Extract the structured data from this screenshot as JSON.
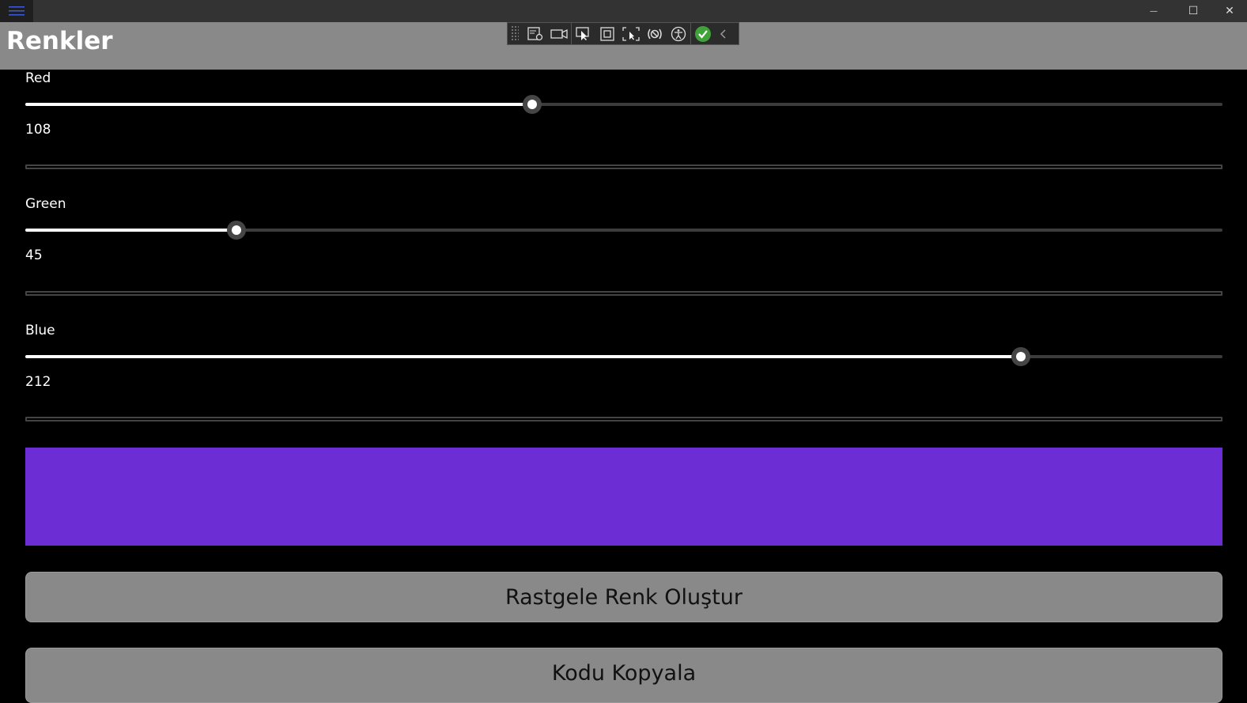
{
  "header": {
    "title": "Renkler"
  },
  "sliders": [
    {
      "label": "Red",
      "value": "108",
      "fraction": 0.4235
    },
    {
      "label": "Green",
      "value": "45",
      "fraction": 0.1765
    },
    {
      "label": "Blue",
      "value": "212",
      "fraction": 0.8314
    }
  ],
  "preview": {
    "color": "#6C2DD4"
  },
  "buttons": {
    "random_label": "Rastgele Renk Oluştur",
    "copy_label": "Kodu Kopyala"
  },
  "window": {
    "minimize_glyph": "—",
    "maximize_glyph": "☐",
    "close_glyph": "✕"
  }
}
